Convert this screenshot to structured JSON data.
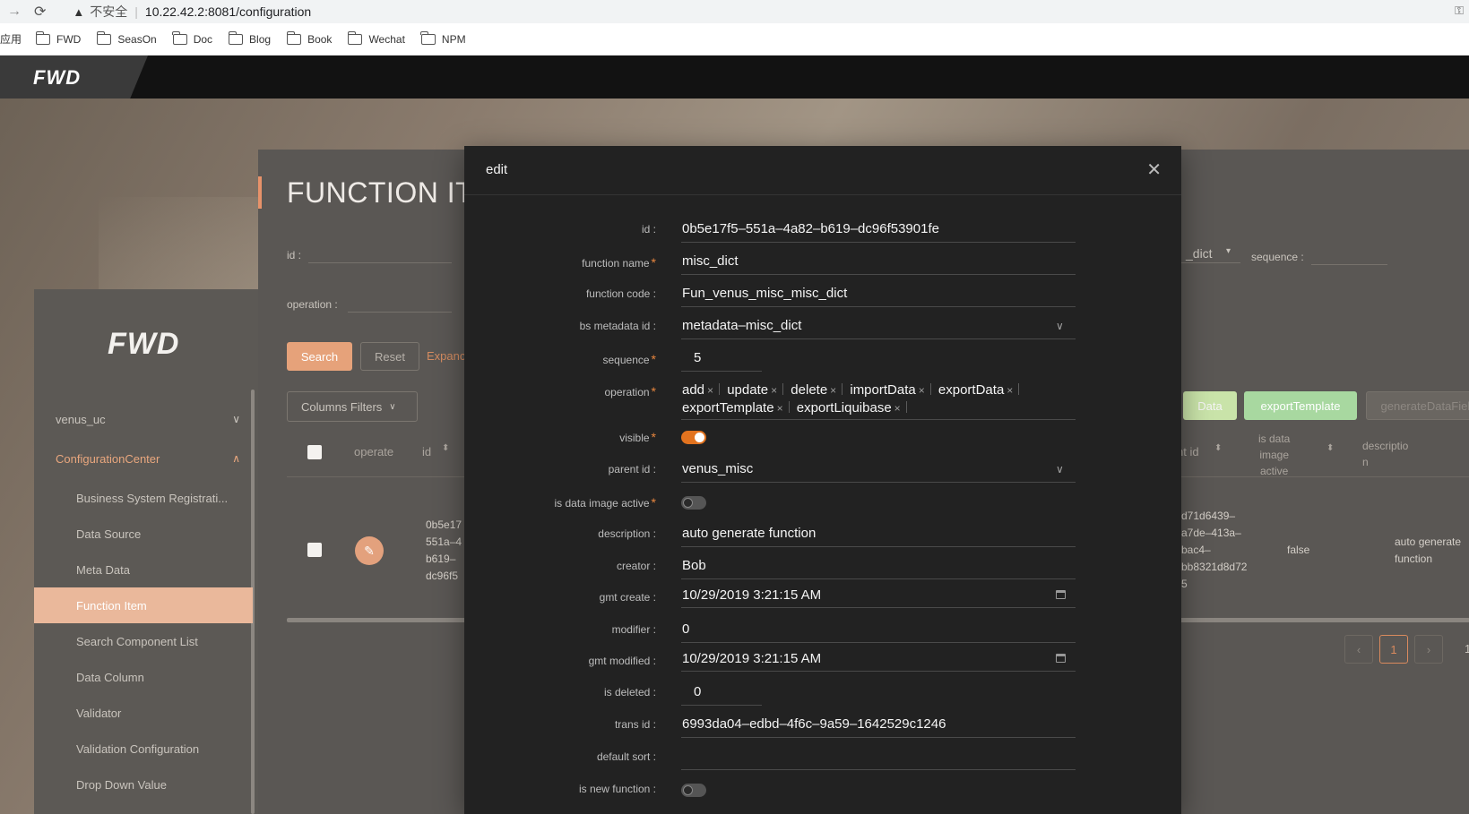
{
  "browser": {
    "insecure_label": "不安全",
    "url": "10.22.42.2:8081/configuration",
    "apps_label": "应用",
    "bookmarks": [
      "FWD",
      "SeasOn",
      "Doc",
      "Blog",
      "Book",
      "Wechat",
      "NPM"
    ]
  },
  "header": {
    "logo": "FWD"
  },
  "sidebar": {
    "logo": "FWD",
    "groups": [
      {
        "label": "venus_uc"
      },
      {
        "label": "ConfigurationCenter"
      }
    ],
    "items": [
      {
        "label": "Business System Registrati..."
      },
      {
        "label": "Data Source"
      },
      {
        "label": "Meta Data"
      },
      {
        "label": "Function Item"
      },
      {
        "label": "Search Component List"
      },
      {
        "label": "Data Column"
      },
      {
        "label": "Validator"
      },
      {
        "label": "Validation Configuration"
      },
      {
        "label": "Drop Down Value"
      }
    ]
  },
  "page": {
    "title": "FUNCTION IT",
    "filters": {
      "id_label": "id :",
      "operation_label": "operation :",
      "dict_value": "_dict",
      "sequence_label": "sequence :"
    },
    "search_label": "Search",
    "reset_label": "Reset",
    "expand_label": "Expanc",
    "columns_filters_label": "Columns Filters",
    "table": {
      "headers": {
        "operate": "operate",
        "id": "id",
        "parent_id": "parent id",
        "is_data_image_active": [
          "is data",
          "image",
          "active"
        ],
        "description": [
          "descriptio",
          "n"
        ]
      },
      "row": {
        "id_lines": [
          "0b5e17",
          "551a–4",
          "b619–",
          "dc96f5"
        ],
        "parent_id_lines": [
          "d71d6439–",
          "a7de–413a–",
          "bac4–",
          "bb8321d8d72",
          "5"
        ],
        "is_data_image_active": "false",
        "description_lines": [
          "auto generate",
          "function"
        ]
      }
    },
    "actions": {
      "partial_data": "Data",
      "export_template": "exportTemplate",
      "generate_data_field": "generateDataField"
    },
    "pagination": {
      "current_page": "1",
      "partial_next": "1"
    }
  },
  "modal": {
    "title": "edit",
    "fields": {
      "id": {
        "label": "id :",
        "value": "0b5e17f5–551a–4a82–b619–dc96f53901fe"
      },
      "function_name": {
        "label": "function name",
        "value": "misc_dict"
      },
      "function_code": {
        "label": "function code :",
        "value": "Fun_venus_misc_misc_dict"
      },
      "bs_metadata_id": {
        "label": "bs metadata id :",
        "value": "metadata–misc_dict"
      },
      "sequence": {
        "label": "sequence",
        "value": "5"
      },
      "operation": {
        "label": "operation",
        "tags": [
          "add",
          "update",
          "delete",
          "importData",
          "exportData",
          "exportTemplate",
          "exportLiquibase"
        ]
      },
      "visible": {
        "label": "visible",
        "checked": true
      },
      "parent_id": {
        "label": "parent id :",
        "value": "venus_misc"
      },
      "is_data_image_active": {
        "label": "is data image active",
        "checked": false
      },
      "description": {
        "label": "description :",
        "value": "auto generate function"
      },
      "creator": {
        "label": "creator :",
        "value": "Bob"
      },
      "gmt_create": {
        "label": "gmt create :",
        "value": "10/29/2019 3:21:15 AM"
      },
      "modifier": {
        "label": "modifier :",
        "value": "0"
      },
      "gmt_modified": {
        "label": "gmt modified :",
        "value": "10/29/2019 3:21:15 AM"
      },
      "is_deleted": {
        "label": "is deleted :",
        "value": "0"
      },
      "trans_id": {
        "label": "trans id :",
        "value": "6993da04–edbd–4f6c–9a59–1642529c1246"
      },
      "default_sort": {
        "label": "default sort :",
        "value": ""
      },
      "is_new_function": {
        "label": "is new function :",
        "checked": false
      }
    }
  },
  "colors": {
    "accent": "#e2731f",
    "primary_button": "#e6a27a",
    "modal_bg": "#222222",
    "header_bg": "#121212",
    "export_button": "#a8d8a0"
  },
  "icons": [
    "back-arrow-icon",
    "reload-icon",
    "warning-icon",
    "key-icon",
    "folder-icon",
    "chevron-down-icon",
    "chevron-up-icon",
    "close-icon",
    "edit-icon",
    "calendar-icon",
    "sort-icon"
  ]
}
